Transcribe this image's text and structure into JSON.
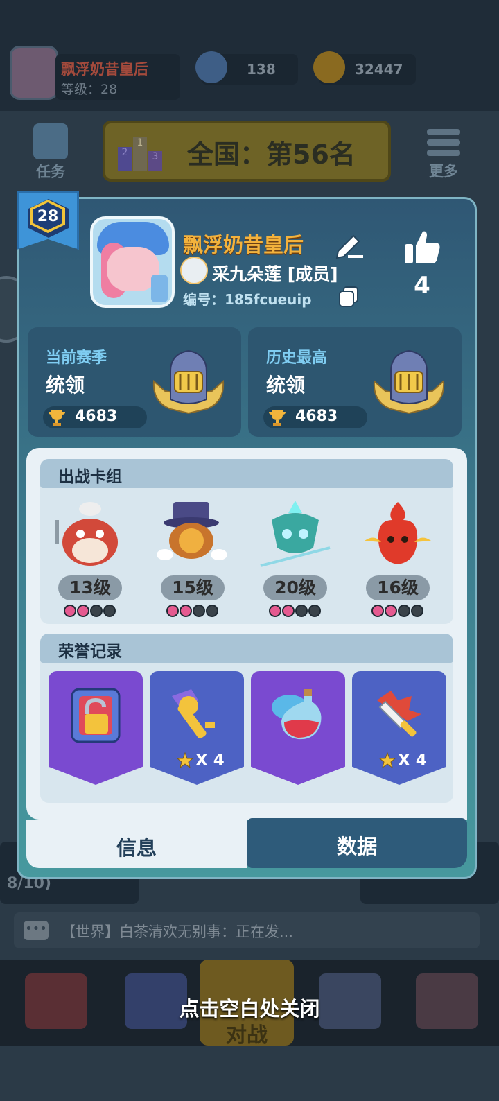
{
  "background": {
    "player_name": "飘浮奶昔皇后",
    "player_level_label": "等级：28",
    "gems": "138",
    "coins": "32447",
    "tasks_label": "任务",
    "rank_banner": "全国：第56名",
    "more_label": "更多",
    "progress_text": "8/10)",
    "chat_text": "【世界】白茶清欢无别事：正在发...",
    "battle_label": "对战",
    "podium_numbers": [
      "2",
      "1",
      "3"
    ]
  },
  "close_hint": "点击空白处关闭",
  "profile": {
    "level": "28",
    "name": "飘浮奶昔皇后",
    "clan": "采九朵莲 [成员]",
    "id_label": "编号：185fcueuip",
    "likes": "4"
  },
  "season": {
    "current": {
      "title": "当前赛季",
      "rank": "统领",
      "trophies": "4683"
    },
    "best": {
      "title": "历史最高",
      "rank": "统领",
      "trophies": "4683"
    }
  },
  "deck": {
    "title": "出战卡组",
    "units": [
      {
        "name": "chef-monster",
        "level": "13级",
        "stars_filled": 2,
        "stars_total": 4
      },
      {
        "name": "magician",
        "level": "15级",
        "stars_filled": 2,
        "stars_total": 4
      },
      {
        "name": "ice-spirit",
        "level": "20级",
        "stars_filled": 2,
        "stars_total": 4
      },
      {
        "name": "fire-bird",
        "level": "16级",
        "stars_filled": 2,
        "stars_total": 4
      }
    ]
  },
  "honors": {
    "title": "荣誉记录",
    "items": [
      {
        "icon": "padlock-card-icon",
        "count": ""
      },
      {
        "icon": "golden-key-icon",
        "count": "X 4"
      },
      {
        "icon": "potion-bottle-icon",
        "count": ""
      },
      {
        "icon": "flaming-sword-icon",
        "count": "X 4"
      }
    ]
  },
  "tabs": {
    "info": "信息",
    "data": "数据"
  },
  "colors": {
    "name": "#f3b23c",
    "accent_blue": "#7fcdf2",
    "tab_active_bg": "#e9f1f6",
    "tab_inactive_bg": "#2e5b7a"
  }
}
